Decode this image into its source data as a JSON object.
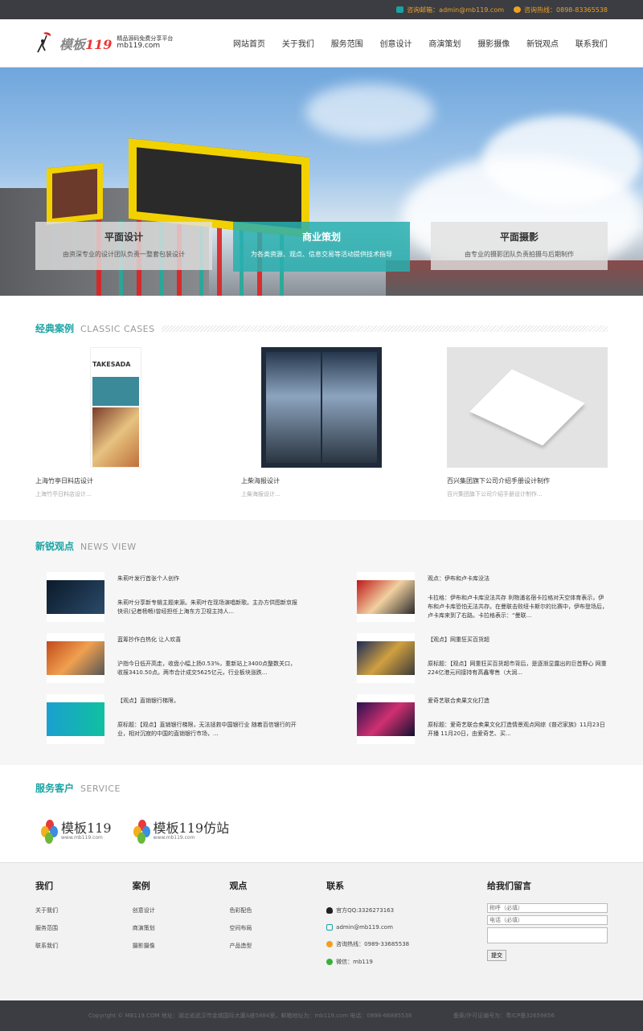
{
  "topbar": {
    "email": "咨询邮箱：admin@mb119.com",
    "hotline": "咨询热线：0898-83365538"
  },
  "logo": {
    "brand": "模板",
    "num": "119",
    "slogan": "精品源码免费分享平台",
    "domain": "mb119.com"
  },
  "nav": [
    "网站首页",
    "关于我们",
    "服务范围",
    "创意设计",
    "商演策划",
    "摄影摄像",
    "新锐观点",
    "联系我们"
  ],
  "hero": {
    "cards": [
      {
        "title": "平面设计",
        "desc": "由资深专业的设计团队负责一整套包装设计"
      },
      {
        "title": "商业策划",
        "desc": "为各类资源、观点、信息交易等活动提供技术指导"
      },
      {
        "title": "平面摄影",
        "desc": "由专业的摄影团队负责拍摄与后期制作"
      }
    ]
  },
  "cases": {
    "title_cn": "经典案例",
    "title_en": "CLASSIC CASES",
    "items": [
      {
        "title": "上海竹亭日料店设计",
        "desc": "上海竹亭日料店设计..."
      },
      {
        "title": "上柴海报设计",
        "desc": "上柴海报设计..."
      },
      {
        "title": "百兴集团旗下公司介绍手册设计制作",
        "desc": "百兴集团旗下公司介绍手册设计制作..."
      }
    ],
    "img1_text": "TAKESADA"
  },
  "news": {
    "title_cn": "新锐观点",
    "title_en": "NEWS VIEW",
    "items": [
      {
        "title": "朱莉叶发行首张个人创作",
        "desc": "朱莉叶分享新专辑主题来源。朱莉叶在现场演唱新歌。主办方供图新京报快讯(记者杨畅)曾经担任上海东方卫视主持人..."
      },
      {
        "title": "观点：伊布和卢卡库没法",
        "desc": "卡拉格：伊布和卢卡库没法共存 利物浦名宿卡拉格对天空体育表示，伊布和卢卡库恐怕无法共存。在曼联击败纽卡斯尔的比赛中，伊布登场后，卢卡库来到了右路。卡拉格表示：“曼联..."
      },
      {
        "title": "蓝筹抄作白热化 让人欢喜",
        "desc": "沪指今日低开高走，收盘小幅上扬0.53%，重新站上3400点整数关口，收报3410.50点。两市合计成交5625亿元，行业板块涨跌..."
      },
      {
        "title": "【观点】网重狂买百货超",
        "desc": "原标题：【观点】网重狂买百货超市背后，是逐渐显露出的巨首野心 网重224亿港元间接持有高鑫零售（大润..."
      },
      {
        "title": "【观点】直销银行梯限，",
        "desc": "原标题：【观点】直销银行梯限，无法拯救中国银行业 随着百信银行的开业，相对沉寂的中国的直销银行市场，..."
      },
      {
        "title": "爱奇艺联合卖果文化打造",
        "desc": "原标题：爱奇艺联合卖果文化打造情景观点网综《普迟家族》11月23日开播 11月20日，由爱奇艺、买..."
      }
    ]
  },
  "clients": {
    "title_cn": "服务客户",
    "title_en": "SERVICE",
    "items": [
      {
        "name": "模板119",
        "url": "www.mb119.com"
      },
      {
        "name": "模板119仿站",
        "url": "www.mb119.com"
      }
    ]
  },
  "footer": {
    "cols": [
      {
        "title": "我们",
        "links": [
          "关于我们",
          "服务范围",
          "联系我们"
        ]
      },
      {
        "title": "案例",
        "links": [
          "创意设计",
          "商演策划",
          "摄影摄像"
        ]
      },
      {
        "title": "观点",
        "links": [
          "色彩配色",
          "空间布局",
          "产品造型"
        ]
      }
    ],
    "contact": {
      "title": "联系",
      "qq": "官方QQ:3326273163",
      "email": "admin@mb119.com",
      "phone": "咨询热线：0989-33685538",
      "wechat": "微信：mb119"
    },
    "form": {
      "title": "给我们留言",
      "name_ph": "称呼（必填）",
      "phone_ph": "电话（必填）",
      "submit": "提交"
    }
  },
  "bottom": {
    "copyright": "Copyright © MB119.COM 地址：湖北省武汉市金城国际大厦A座5884室，邮箱地址为：mb119.com 电话：0898-66885538",
    "icp": "备案/许可证编号为：粤ICP备32659856"
  },
  "colors": {
    "accent": "#1aa3a3",
    "topbar": "#3b3d42",
    "topbar_text": "#f0a020"
  }
}
